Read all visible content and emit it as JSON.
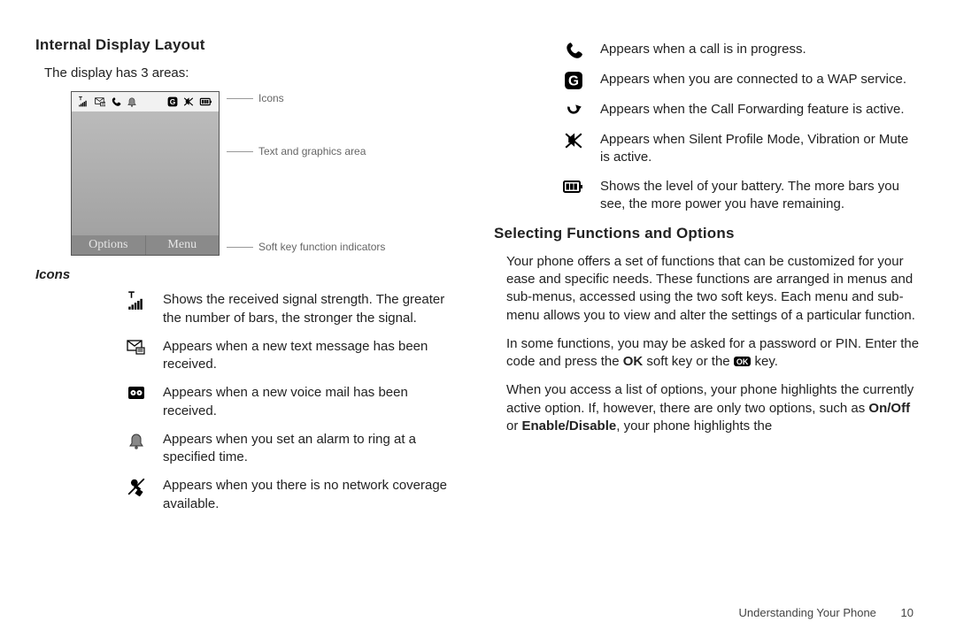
{
  "left": {
    "heading": "Internal Display Layout",
    "intro": "The display has 3 areas:",
    "phone": {
      "softkeys": {
        "left": "Options",
        "right": "Menu"
      },
      "callouts": {
        "top": "Icons",
        "mid": "Text and graphics area",
        "bot": "Soft key function indicators"
      }
    },
    "sub": "Icons",
    "rows": [
      {
        "icon": "signal",
        "text": "Shows the received signal strength. The greater the number of bars, the stronger the signal."
      },
      {
        "icon": "msg",
        "text": "Appears when a new text message has been received."
      },
      {
        "icon": "vmail",
        "text": "Appears when a new voice mail has been received."
      },
      {
        "icon": "alarm",
        "text": "Appears when you set an alarm to ring at a specified time."
      },
      {
        "icon": "nocov",
        "text": "Appears when you there is no network coverage available."
      }
    ]
  },
  "right": {
    "rows": [
      {
        "icon": "call",
        "text": "Appears when a call is in progress."
      },
      {
        "icon": "wap",
        "text": "Appears when you are connected to a WAP service."
      },
      {
        "icon": "fwd",
        "text": "Appears when the Call Forwarding feature is active."
      },
      {
        "icon": "silent",
        "text": "Appears when Silent Profile Mode, Vibration or Mute is active."
      },
      {
        "icon": "batt",
        "text": "Shows the level of your battery. The more bars you see, the more power you have remaining."
      }
    ],
    "heading": "Selecting Functions and Options",
    "p1_pre": "Your phone offers a set of functions that can be customized for your ease and specific needs. These functions are arranged in menus and sub-menus, accessed using the two soft keys. Each menu and sub-menu allows you to view and alter the settings of a particular function.",
    "p2_a": "In some functions, you may be asked for a password or PIN. Enter the code and press the ",
    "p2_ok": "OK",
    "p2_b": " soft key or the ",
    "p2_pill": "OK",
    "p2_c": " key.",
    "p3_a": "When you access a list of options, your phone highlights the currently active option. If, however, there are only two options, such as ",
    "p3_b1": "On/Off",
    "p3_m": " or ",
    "p3_b2": "Enable/Disable",
    "p3_c": ", your phone highlights the"
  },
  "footer": {
    "section": "Understanding Your Phone",
    "page": "10"
  }
}
